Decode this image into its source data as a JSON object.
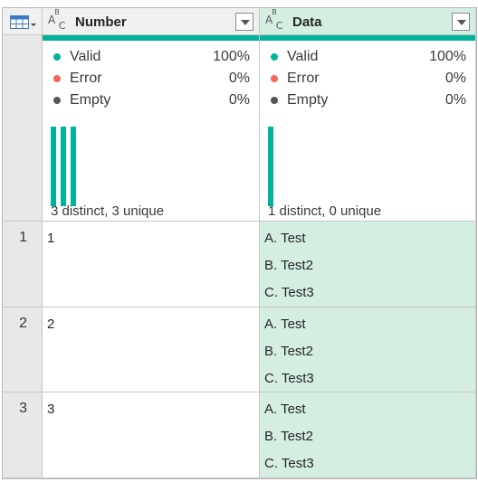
{
  "columns": [
    {
      "name": "Number",
      "type_icon": "ABC",
      "quality": {
        "valid_label": "Valid",
        "valid_pct": "100%",
        "error_label": "Error",
        "error_pct": "0%",
        "empty_label": "Empty",
        "empty_pct": "0%"
      },
      "distinct_text": "3 distinct, 3 unique",
      "distribution": [
        1,
        1,
        1
      ]
    },
    {
      "name": "Data",
      "type_icon": "ABC",
      "quality": {
        "valid_label": "Valid",
        "valid_pct": "100%",
        "error_label": "Error",
        "error_pct": "0%",
        "empty_label": "Empty",
        "empty_pct": "0%"
      },
      "distinct_text": "1 distinct, 0 unique",
      "distribution": [
        1
      ]
    }
  ],
  "rows": [
    {
      "index": "1",
      "number": "1",
      "data": [
        "A. Test",
        "B. Test2",
        "C. Test3"
      ]
    },
    {
      "index": "2",
      "number": "2",
      "data": [
        "A. Test",
        "B. Test2",
        "C. Test3"
      ]
    },
    {
      "index": "3",
      "number": "3",
      "data": [
        "A. Test",
        "B. Test2",
        "C. Test3"
      ]
    }
  ],
  "colors": {
    "valid": "#00b39a",
    "error": "#f1675b",
    "empty": "#555555",
    "selected_column": "#d4eee2",
    "header_bg": "#f0f0f0"
  },
  "icons": {
    "corner": "table-icon",
    "column_type": "text-type-icon",
    "filter": "chevron-down-icon"
  }
}
